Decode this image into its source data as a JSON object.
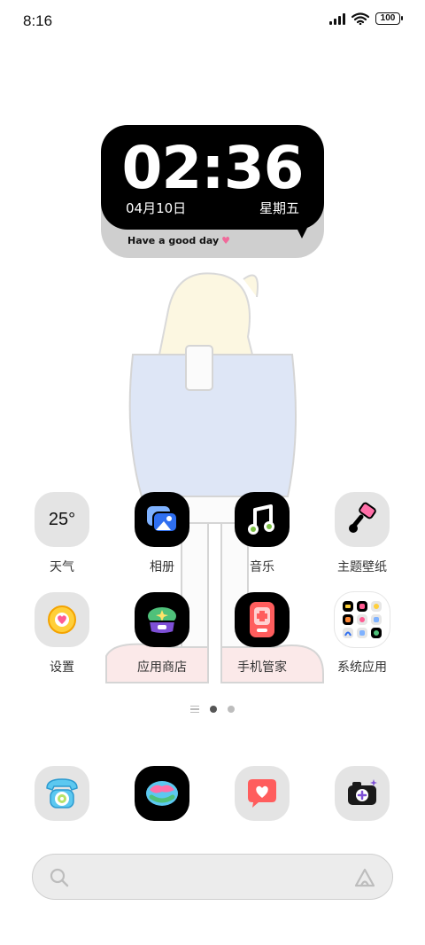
{
  "status_bar": {
    "time": "8:16",
    "battery": "100"
  },
  "clock_widget": {
    "time": "02:36",
    "date": "04月10日",
    "weekday": "星期五",
    "greeting": "Have a good day",
    "heart": "♥"
  },
  "apps_row1": [
    {
      "label": "天气",
      "icon": "weather-icon",
      "value": "25°"
    },
    {
      "label": "相册",
      "icon": "gallery-icon"
    },
    {
      "label": "音乐",
      "icon": "music-icon"
    },
    {
      "label": "主题壁纸",
      "icon": "theme-brush-icon"
    }
  ],
  "apps_row2": [
    {
      "label": "设置",
      "icon": "settings-icon"
    },
    {
      "label": "应用商店",
      "icon": "app-store-icon"
    },
    {
      "label": "手机管家",
      "icon": "phone-manager-icon"
    },
    {
      "label": "系统应用",
      "icon": "system-apps-folder-icon"
    }
  ],
  "dock": [
    {
      "icon": "phone-icon"
    },
    {
      "icon": "browser-globe-icon"
    },
    {
      "icon": "messages-heart-icon"
    },
    {
      "icon": "camera-icon"
    }
  ],
  "search_bar": {
    "left_icon": "search-icon",
    "right_icon": "assistant-icon"
  },
  "colors": {
    "accent_pink": "#f06a9a",
    "tile_dark": "#000000",
    "tile_light": "#e4e4e4"
  }
}
